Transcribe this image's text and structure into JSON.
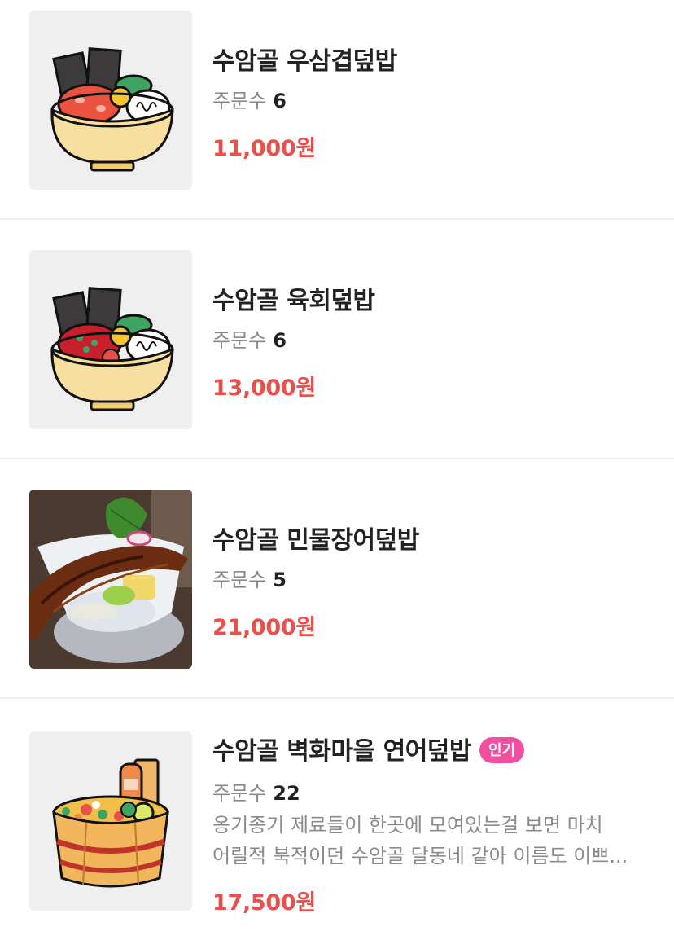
{
  "menu_items": [
    {
      "name": "수암골 우삼겹덮밥",
      "orders_label": "주문수",
      "orders": "6",
      "price": "11,000원",
      "image": "bowl-illustration-beef"
    },
    {
      "name": "수암골 육회덮밥",
      "orders_label": "주문수",
      "orders": "6",
      "price": "13,000원",
      "image": "bowl-illustration-yukhoe"
    },
    {
      "name": "수암골 민물장어덮밥",
      "orders_label": "주문수",
      "orders": "5",
      "price": "21,000원",
      "image": "eel-rice-bowl-photo"
    },
    {
      "name": "수암골 벽화마을 연어덮밥",
      "badge": "인기",
      "orders_label": "주문수",
      "orders": "22",
      "description": [
        "옹기종기 제료들이 한곳에 모여있는걸 보면 마치",
        "어릴적 북적이던 수암골 달동네 같아 이름도 이쁘..."
      ],
      "price": "17,500원",
      "image": "salmon-wooden-bowl-illustration"
    }
  ],
  "colors": {
    "price": "#e8504b",
    "badge": "#ef4f9e",
    "thumb_bg": "#efefef"
  }
}
